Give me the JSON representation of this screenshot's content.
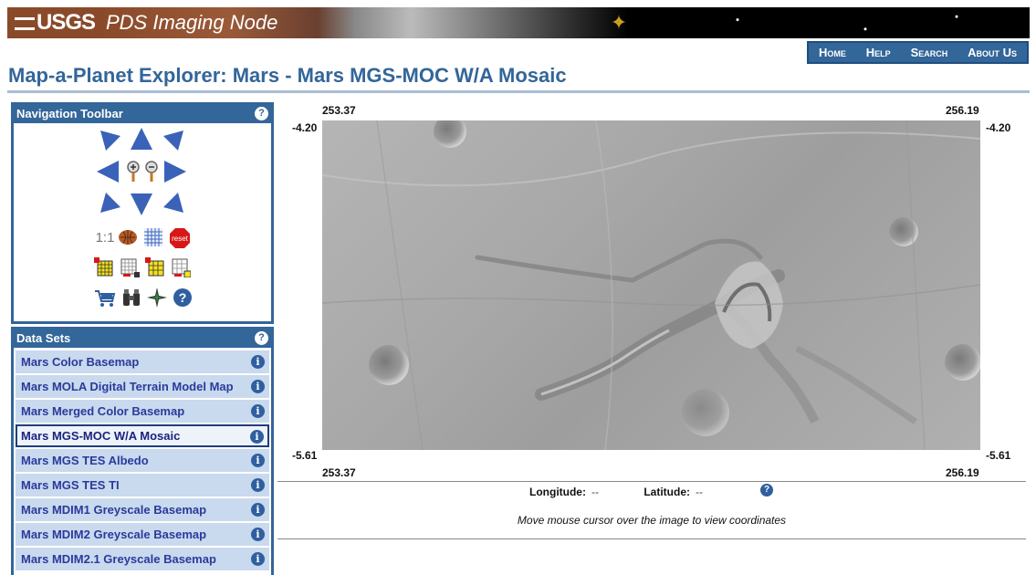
{
  "banner": {
    "usgs": "USGS",
    "node": "PDS Imaging Node"
  },
  "topnav": [
    "Home",
    "Help",
    "Search",
    "About Us"
  ],
  "title": "Map-a-Planet Explorer: Mars - Mars MGS-MOC W/A Mosaic",
  "nav_panel": {
    "title": "Navigation Toolbar",
    "help": "?",
    "one_to_one": "1:1",
    "reset": "reset"
  },
  "data_panel": {
    "title": "Data Sets",
    "help": "?",
    "items": [
      "Mars Color Basemap",
      "Mars MOLA Digital Terrain Model Map",
      "Mars Merged Color Basemap",
      "Mars MGS-MOC W/A Mosaic",
      "Mars MGS TES Albedo",
      "Mars MGS TES TI",
      "Mars MDIM1 Greyscale Basemap",
      "Mars MDIM2 Greyscale Basemap",
      "Mars MDIM2.1 Greyscale Basemap"
    ],
    "selected": "Mars MGS-MOC W/A Mosaic",
    "info_glyph": "i"
  },
  "map": {
    "lon_left": "253.37",
    "lon_right": "256.19",
    "lat_top": "-4.20",
    "lat_bottom": "-5.61"
  },
  "readout": {
    "lon_label": "Longitude:",
    "lon_value": "--",
    "lat_label": "Latitude:",
    "lat_value": "--",
    "help": "?",
    "hint": "Move mouse cursor over the image to view coordinates"
  }
}
